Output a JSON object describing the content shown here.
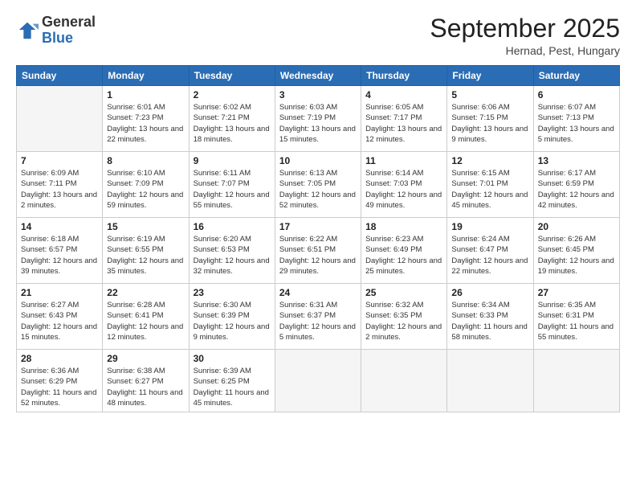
{
  "logo": {
    "general": "General",
    "blue": "Blue"
  },
  "title": "September 2025",
  "location": "Hernad, Pest, Hungary",
  "weekdays": [
    "Sunday",
    "Monday",
    "Tuesday",
    "Wednesday",
    "Thursday",
    "Friday",
    "Saturday"
  ],
  "weeks": [
    [
      {
        "day": null
      },
      {
        "day": "1",
        "sunrise": "6:01 AM",
        "sunset": "7:23 PM",
        "daylight": "13 hours and 22 minutes."
      },
      {
        "day": "2",
        "sunrise": "6:02 AM",
        "sunset": "7:21 PM",
        "daylight": "13 hours and 18 minutes."
      },
      {
        "day": "3",
        "sunrise": "6:03 AM",
        "sunset": "7:19 PM",
        "daylight": "13 hours and 15 minutes."
      },
      {
        "day": "4",
        "sunrise": "6:05 AM",
        "sunset": "7:17 PM",
        "daylight": "13 hours and 12 minutes."
      },
      {
        "day": "5",
        "sunrise": "6:06 AM",
        "sunset": "7:15 PM",
        "daylight": "13 hours and 9 minutes."
      },
      {
        "day": "6",
        "sunrise": "6:07 AM",
        "sunset": "7:13 PM",
        "daylight": "13 hours and 5 minutes."
      }
    ],
    [
      {
        "day": "7",
        "sunrise": "6:09 AM",
        "sunset": "7:11 PM",
        "daylight": "13 hours and 2 minutes."
      },
      {
        "day": "8",
        "sunrise": "6:10 AM",
        "sunset": "7:09 PM",
        "daylight": "12 hours and 59 minutes."
      },
      {
        "day": "9",
        "sunrise": "6:11 AM",
        "sunset": "7:07 PM",
        "daylight": "12 hours and 55 minutes."
      },
      {
        "day": "10",
        "sunrise": "6:13 AM",
        "sunset": "7:05 PM",
        "daylight": "12 hours and 52 minutes."
      },
      {
        "day": "11",
        "sunrise": "6:14 AM",
        "sunset": "7:03 PM",
        "daylight": "12 hours and 49 minutes."
      },
      {
        "day": "12",
        "sunrise": "6:15 AM",
        "sunset": "7:01 PM",
        "daylight": "12 hours and 45 minutes."
      },
      {
        "day": "13",
        "sunrise": "6:17 AM",
        "sunset": "6:59 PM",
        "daylight": "12 hours and 42 minutes."
      }
    ],
    [
      {
        "day": "14",
        "sunrise": "6:18 AM",
        "sunset": "6:57 PM",
        "daylight": "12 hours and 39 minutes."
      },
      {
        "day": "15",
        "sunrise": "6:19 AM",
        "sunset": "6:55 PM",
        "daylight": "12 hours and 35 minutes."
      },
      {
        "day": "16",
        "sunrise": "6:20 AM",
        "sunset": "6:53 PM",
        "daylight": "12 hours and 32 minutes."
      },
      {
        "day": "17",
        "sunrise": "6:22 AM",
        "sunset": "6:51 PM",
        "daylight": "12 hours and 29 minutes."
      },
      {
        "day": "18",
        "sunrise": "6:23 AM",
        "sunset": "6:49 PM",
        "daylight": "12 hours and 25 minutes."
      },
      {
        "day": "19",
        "sunrise": "6:24 AM",
        "sunset": "6:47 PM",
        "daylight": "12 hours and 22 minutes."
      },
      {
        "day": "20",
        "sunrise": "6:26 AM",
        "sunset": "6:45 PM",
        "daylight": "12 hours and 19 minutes."
      }
    ],
    [
      {
        "day": "21",
        "sunrise": "6:27 AM",
        "sunset": "6:43 PM",
        "daylight": "12 hours and 15 minutes."
      },
      {
        "day": "22",
        "sunrise": "6:28 AM",
        "sunset": "6:41 PM",
        "daylight": "12 hours and 12 minutes."
      },
      {
        "day": "23",
        "sunrise": "6:30 AM",
        "sunset": "6:39 PM",
        "daylight": "12 hours and 9 minutes."
      },
      {
        "day": "24",
        "sunrise": "6:31 AM",
        "sunset": "6:37 PM",
        "daylight": "12 hours and 5 minutes."
      },
      {
        "day": "25",
        "sunrise": "6:32 AM",
        "sunset": "6:35 PM",
        "daylight": "12 hours and 2 minutes."
      },
      {
        "day": "26",
        "sunrise": "6:34 AM",
        "sunset": "6:33 PM",
        "daylight": "11 hours and 58 minutes."
      },
      {
        "day": "27",
        "sunrise": "6:35 AM",
        "sunset": "6:31 PM",
        "daylight": "11 hours and 55 minutes."
      }
    ],
    [
      {
        "day": "28",
        "sunrise": "6:36 AM",
        "sunset": "6:29 PM",
        "daylight": "11 hours and 52 minutes."
      },
      {
        "day": "29",
        "sunrise": "6:38 AM",
        "sunset": "6:27 PM",
        "daylight": "11 hours and 48 minutes."
      },
      {
        "day": "30",
        "sunrise": "6:39 AM",
        "sunset": "6:25 PM",
        "daylight": "11 hours and 45 minutes."
      },
      {
        "day": null
      },
      {
        "day": null
      },
      {
        "day": null
      },
      {
        "day": null
      }
    ]
  ]
}
